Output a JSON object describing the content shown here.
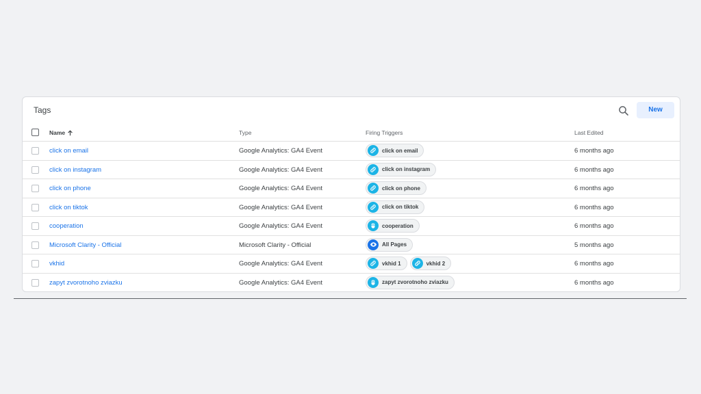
{
  "card": {
    "title": "Tags",
    "new_label": "New"
  },
  "columns": {
    "name": "Name",
    "type": "Type",
    "triggers": "Firing Triggers",
    "last_edited": "Last Edited"
  },
  "colors": {
    "link": "#1a73e8",
    "click_trigger": "#1cb4e6",
    "pageview_trigger": "#1a73e8",
    "new_button_bg": "#e8f0fe"
  },
  "rows": [
    {
      "name": "click on email",
      "type": "Google Analytics: GA4 Event",
      "edited": "6 months ago",
      "triggers": [
        {
          "label": "click on email",
          "icon": "link-icon"
        }
      ]
    },
    {
      "name": "click on instagram",
      "type": "Google Analytics: GA4 Event",
      "edited": "6 months ago",
      "triggers": [
        {
          "label": "click on instagram",
          "icon": "link-icon"
        }
      ]
    },
    {
      "name": "click on phone",
      "type": "Google Analytics: GA4 Event",
      "edited": "6 months ago",
      "triggers": [
        {
          "label": "click on phone",
          "icon": "link-icon"
        }
      ]
    },
    {
      "name": "click on tiktok",
      "type": "Google Analytics: GA4 Event",
      "edited": "6 months ago",
      "triggers": [
        {
          "label": "click on tiktok",
          "icon": "link-icon"
        }
      ]
    },
    {
      "name": "cooperation",
      "type": "Google Analytics: GA4 Event",
      "edited": "6 months ago",
      "triggers": [
        {
          "label": "cooperation",
          "icon": "mouse-icon"
        }
      ]
    },
    {
      "name": "Microsoft Clarity - Official",
      "type": "Microsoft Clarity - Official",
      "edited": "5 months ago",
      "triggers": [
        {
          "label": "All Pages",
          "icon": "eye-icon"
        }
      ]
    },
    {
      "name": "vkhid",
      "type": "Google Analytics: GA4 Event",
      "edited": "6 months ago",
      "triggers": [
        {
          "label": "vkhid 1",
          "icon": "link-icon"
        },
        {
          "label": "vkhid 2",
          "icon": "link-icon"
        }
      ]
    },
    {
      "name": "zapyt zvorotnoho zviazku",
      "type": "Google Analytics: GA4 Event",
      "edited": "6 months ago",
      "triggers": [
        {
          "label": "zapyt zvorotnoho zviazku",
          "icon": "mouse-icon"
        }
      ]
    }
  ]
}
